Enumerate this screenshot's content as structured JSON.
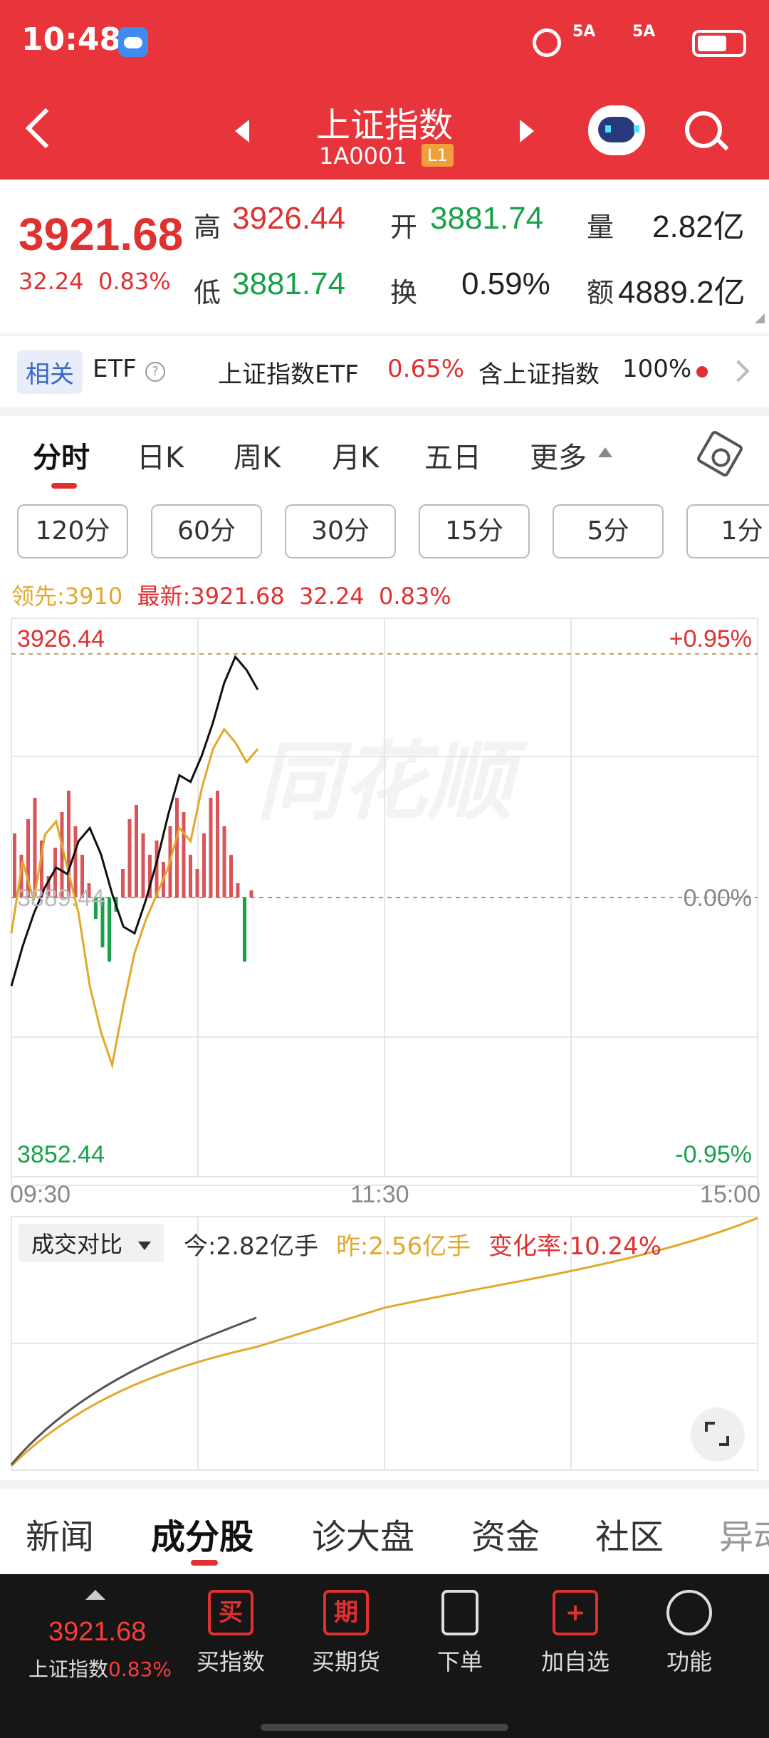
{
  "status": {
    "time": "10:48",
    "sig1": "5A",
    "sig2": "5A"
  },
  "nav": {
    "title": "上证指数",
    "code": "1A0001",
    "badge": "L1"
  },
  "quote": {
    "price": "3921.68",
    "change": "32.24",
    "change_pct": "0.83%",
    "high_label": "高",
    "high": "3926.44",
    "open_label": "开",
    "open": "3881.74",
    "vol_label": "量",
    "vol": "2.82亿",
    "low_label": "低",
    "low": "3881.74",
    "turn_label": "换",
    "turn": "0.59%",
    "amt_label": "额",
    "amt": "4889.2亿"
  },
  "etf": {
    "tag": "相关",
    "label": "ETF",
    "help": "?",
    "name": "上证指数ETF",
    "pct": "0.65%",
    "contain": "含上证指数",
    "weight": "100%"
  },
  "tabs": [
    "分时",
    "日K",
    "周K",
    "月K",
    "五日",
    "更多"
  ],
  "periods": [
    "120分",
    "60分",
    "30分",
    "15分",
    "5分",
    "1分"
  ],
  "legend": {
    "lead": "领先:3910",
    "latest": "最新:3921.68",
    "change": "32.24",
    "pct": "0.83%"
  },
  "chart": {
    "y_high": "3926.44",
    "y_high_pct": "+0.95%",
    "y_mid": "3889.44",
    "y_mid_pct": "0.00%",
    "y_low": "3852.44",
    "y_low_pct": "-0.95%",
    "t_start": "09:30",
    "t_mid": "11:30",
    "t_end": "15:00",
    "watermark": "同花顺"
  },
  "compare": {
    "select": "成交对比",
    "today": "今:2.82亿手",
    "yesterday": "昨:2.56亿手",
    "rate": "变化率:10.24%"
  },
  "chart_data": {
    "type": "line",
    "ylim": [
      3852.44,
      3926.44
    ],
    "series": [
      {
        "name": "最新",
        "values": [
          3876,
          3882,
          3887,
          3891,
          3894,
          3893,
          3898,
          3900,
          3896,
          3890,
          3885,
          3884,
          3889,
          3895,
          3902,
          3908,
          3907,
          3911,
          3916,
          3922,
          3926,
          3924,
          3921
        ]
      },
      {
        "name": "领先",
        "values": [
          3884,
          3895,
          3889,
          3899,
          3901,
          3894,
          3887,
          3876,
          3869,
          3864,
          3873,
          3881,
          3886,
          3890,
          3894,
          3900,
          3898,
          3906,
          3912,
          3915,
          3913,
          3910,
          3912
        ]
      }
    ]
  },
  "bottom_tabs": [
    "新闻",
    "成分股",
    "诊大盘",
    "资金",
    "社区",
    "异动"
  ],
  "dock": {
    "price": "3921.68",
    "name": "上证指数",
    "pct": "0.83%",
    "items": [
      {
        "label": "买指数",
        "icon": "买"
      },
      {
        "label": "买期货",
        "icon": "期"
      },
      {
        "label": "下单",
        "icon": ""
      },
      {
        "label": "加自选",
        "icon": "+"
      },
      {
        "label": "功能",
        "icon": ""
      }
    ]
  },
  "colors": {
    "brand": "#e8343b",
    "up": "#e03030",
    "down": "#19a14a",
    "lead": "#e2a82b"
  }
}
